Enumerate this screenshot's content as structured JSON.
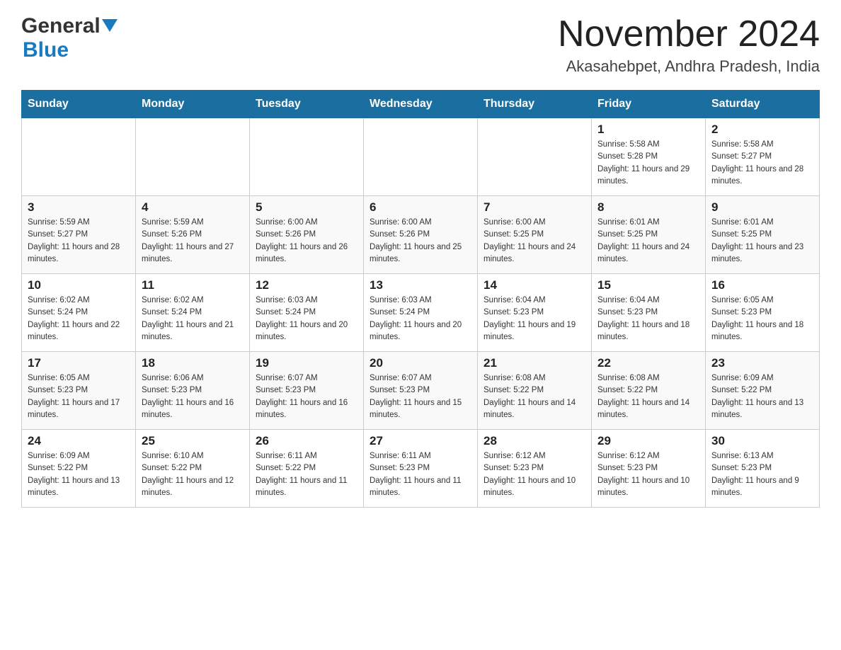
{
  "header": {
    "logo_line1": "General",
    "logo_line2": "Blue",
    "month_title": "November 2024",
    "location": "Akasahebpet, Andhra Pradesh, India"
  },
  "calendar": {
    "days_of_week": [
      "Sunday",
      "Monday",
      "Tuesday",
      "Wednesday",
      "Thursday",
      "Friday",
      "Saturday"
    ],
    "weeks": [
      [
        {
          "day": "",
          "info": ""
        },
        {
          "day": "",
          "info": ""
        },
        {
          "day": "",
          "info": ""
        },
        {
          "day": "",
          "info": ""
        },
        {
          "day": "",
          "info": ""
        },
        {
          "day": "1",
          "info": "Sunrise: 5:58 AM\nSunset: 5:28 PM\nDaylight: 11 hours and 29 minutes."
        },
        {
          "day": "2",
          "info": "Sunrise: 5:58 AM\nSunset: 5:27 PM\nDaylight: 11 hours and 28 minutes."
        }
      ],
      [
        {
          "day": "3",
          "info": "Sunrise: 5:59 AM\nSunset: 5:27 PM\nDaylight: 11 hours and 28 minutes."
        },
        {
          "day": "4",
          "info": "Sunrise: 5:59 AM\nSunset: 5:26 PM\nDaylight: 11 hours and 27 minutes."
        },
        {
          "day": "5",
          "info": "Sunrise: 6:00 AM\nSunset: 5:26 PM\nDaylight: 11 hours and 26 minutes."
        },
        {
          "day": "6",
          "info": "Sunrise: 6:00 AM\nSunset: 5:26 PM\nDaylight: 11 hours and 25 minutes."
        },
        {
          "day": "7",
          "info": "Sunrise: 6:00 AM\nSunset: 5:25 PM\nDaylight: 11 hours and 24 minutes."
        },
        {
          "day": "8",
          "info": "Sunrise: 6:01 AM\nSunset: 5:25 PM\nDaylight: 11 hours and 24 minutes."
        },
        {
          "day": "9",
          "info": "Sunrise: 6:01 AM\nSunset: 5:25 PM\nDaylight: 11 hours and 23 minutes."
        }
      ],
      [
        {
          "day": "10",
          "info": "Sunrise: 6:02 AM\nSunset: 5:24 PM\nDaylight: 11 hours and 22 minutes."
        },
        {
          "day": "11",
          "info": "Sunrise: 6:02 AM\nSunset: 5:24 PM\nDaylight: 11 hours and 21 minutes."
        },
        {
          "day": "12",
          "info": "Sunrise: 6:03 AM\nSunset: 5:24 PM\nDaylight: 11 hours and 20 minutes."
        },
        {
          "day": "13",
          "info": "Sunrise: 6:03 AM\nSunset: 5:24 PM\nDaylight: 11 hours and 20 minutes."
        },
        {
          "day": "14",
          "info": "Sunrise: 6:04 AM\nSunset: 5:23 PM\nDaylight: 11 hours and 19 minutes."
        },
        {
          "day": "15",
          "info": "Sunrise: 6:04 AM\nSunset: 5:23 PM\nDaylight: 11 hours and 18 minutes."
        },
        {
          "day": "16",
          "info": "Sunrise: 6:05 AM\nSunset: 5:23 PM\nDaylight: 11 hours and 18 minutes."
        }
      ],
      [
        {
          "day": "17",
          "info": "Sunrise: 6:05 AM\nSunset: 5:23 PM\nDaylight: 11 hours and 17 minutes."
        },
        {
          "day": "18",
          "info": "Sunrise: 6:06 AM\nSunset: 5:23 PM\nDaylight: 11 hours and 16 minutes."
        },
        {
          "day": "19",
          "info": "Sunrise: 6:07 AM\nSunset: 5:23 PM\nDaylight: 11 hours and 16 minutes."
        },
        {
          "day": "20",
          "info": "Sunrise: 6:07 AM\nSunset: 5:23 PM\nDaylight: 11 hours and 15 minutes."
        },
        {
          "day": "21",
          "info": "Sunrise: 6:08 AM\nSunset: 5:22 PM\nDaylight: 11 hours and 14 minutes."
        },
        {
          "day": "22",
          "info": "Sunrise: 6:08 AM\nSunset: 5:22 PM\nDaylight: 11 hours and 14 minutes."
        },
        {
          "day": "23",
          "info": "Sunrise: 6:09 AM\nSunset: 5:22 PM\nDaylight: 11 hours and 13 minutes."
        }
      ],
      [
        {
          "day": "24",
          "info": "Sunrise: 6:09 AM\nSunset: 5:22 PM\nDaylight: 11 hours and 13 minutes."
        },
        {
          "day": "25",
          "info": "Sunrise: 6:10 AM\nSunset: 5:22 PM\nDaylight: 11 hours and 12 minutes."
        },
        {
          "day": "26",
          "info": "Sunrise: 6:11 AM\nSunset: 5:22 PM\nDaylight: 11 hours and 11 minutes."
        },
        {
          "day": "27",
          "info": "Sunrise: 6:11 AM\nSunset: 5:23 PM\nDaylight: 11 hours and 11 minutes."
        },
        {
          "day": "28",
          "info": "Sunrise: 6:12 AM\nSunset: 5:23 PM\nDaylight: 11 hours and 10 minutes."
        },
        {
          "day": "29",
          "info": "Sunrise: 6:12 AM\nSunset: 5:23 PM\nDaylight: 11 hours and 10 minutes."
        },
        {
          "day": "30",
          "info": "Sunrise: 6:13 AM\nSunset: 5:23 PM\nDaylight: 11 hours and 9 minutes."
        }
      ]
    ]
  }
}
